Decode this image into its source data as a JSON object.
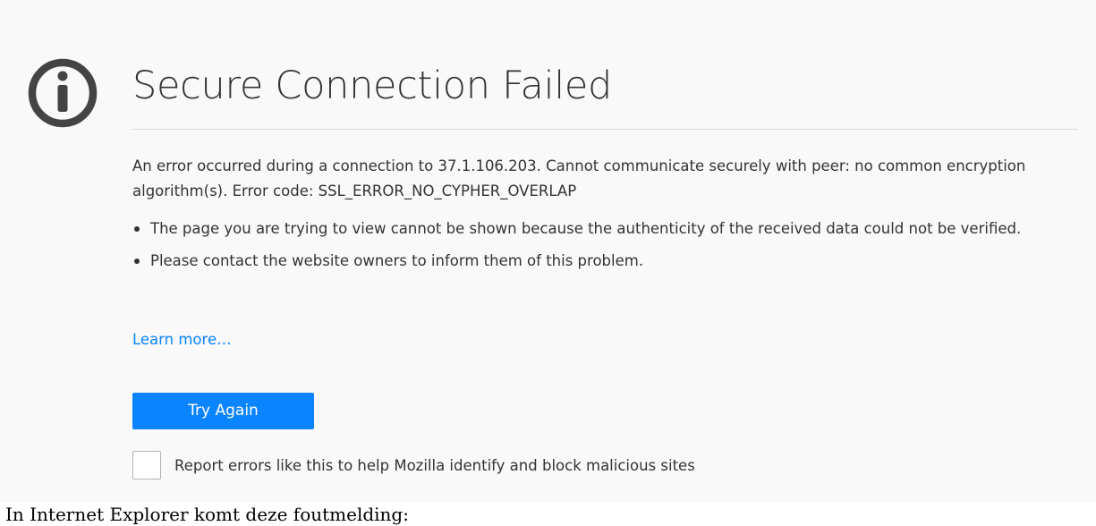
{
  "error_page": {
    "icon": "info-icon",
    "title": "Secure Connection Failed",
    "description": "An error occurred during a connection to 37.1.106.203. Cannot communicate securely with peer: no common encryption algorithm(s). Error code: SSL_ERROR_NO_CYPHER_OVERLAP",
    "bullets": [
      "The page you are trying to view cannot be shown because the authenticity of the received data could not be verified.",
      "Please contact the website owners to inform them of this problem."
    ],
    "learn_more": "Learn more…",
    "try_again": "Try Again",
    "report_checkbox": {
      "checked": false,
      "label": "Report errors like this to help Mozilla identify and block malicious sites"
    }
  },
  "below_text": "In Internet Explorer komt deze foutmelding:",
  "colors": {
    "accent": "#0a84ff",
    "text": "#333333",
    "panel_background": "#f9f9fa",
    "icon": "#444444"
  }
}
